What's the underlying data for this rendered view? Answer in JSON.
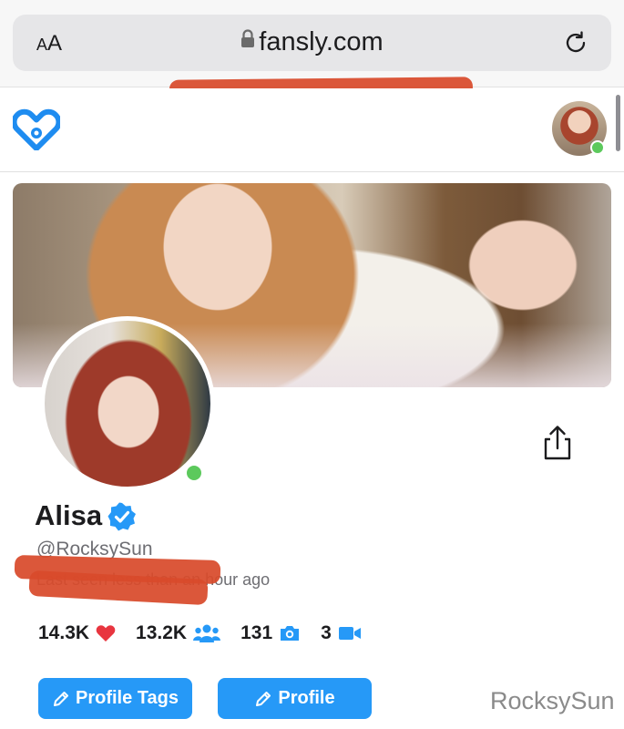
{
  "browser": {
    "aa_small": "A",
    "aa_large": "A",
    "url": "fansly.com"
  },
  "profile": {
    "display_name": "Alisa",
    "username": "@RocksySun",
    "last_seen": "Last seen less than an hour ago"
  },
  "stats": [
    {
      "value": "14.3K",
      "icon": "heart-icon"
    },
    {
      "value": "13.2K",
      "icon": "followers-icon"
    },
    {
      "value": "131",
      "icon": "camera-icon"
    },
    {
      "value": "3",
      "icon": "video-icon"
    }
  ],
  "buttons": {
    "profile_tags": "Profile Tags",
    "profile": "Profile"
  },
  "watermark": "RocksySun",
  "colors": {
    "accent": "#2699f7",
    "online": "#5cc95c",
    "heart": "#e8353f",
    "redaction": "#d84a2b"
  }
}
